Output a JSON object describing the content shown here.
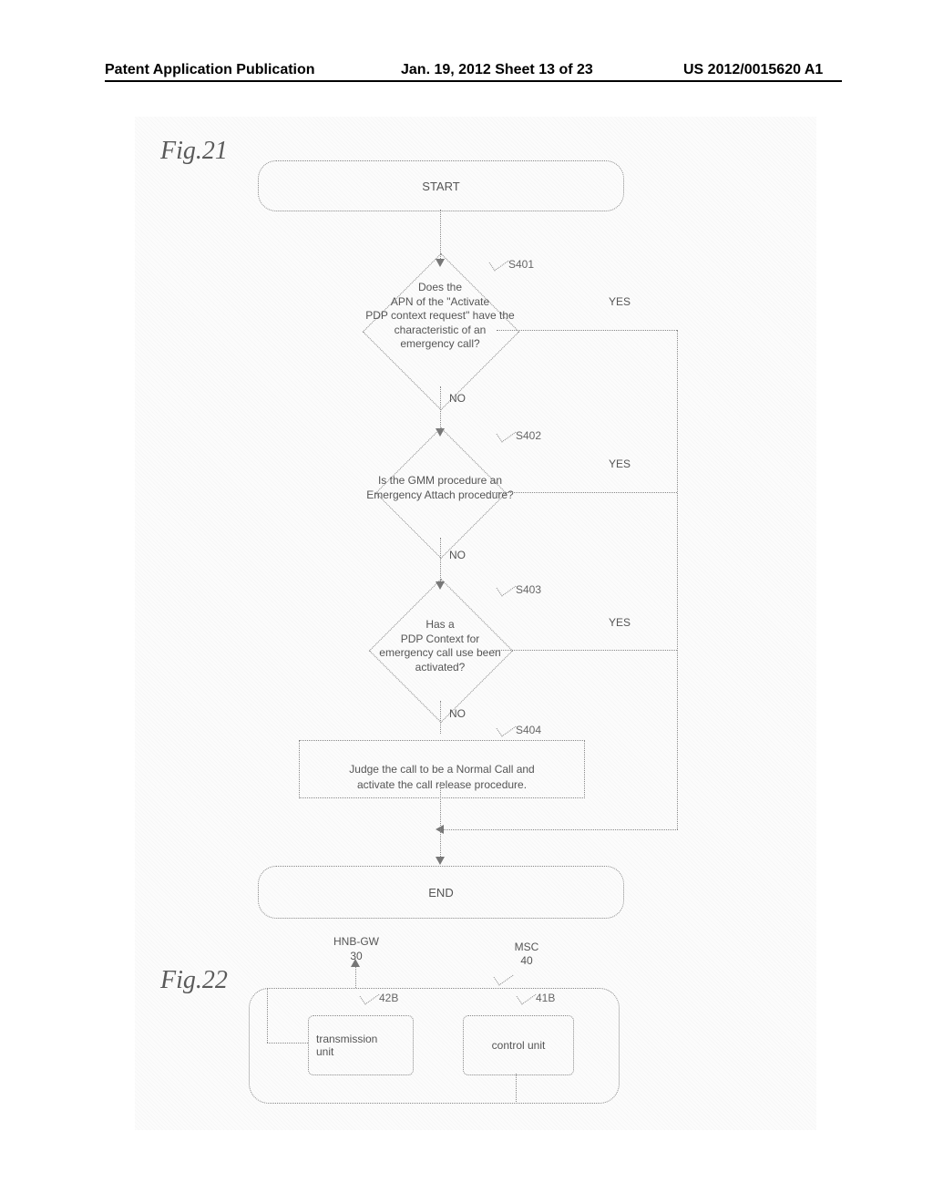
{
  "header": {
    "left": "Patent Application Publication",
    "mid": "Jan. 19, 2012  Sheet 13 of 23",
    "right": "US 2012/0015620 A1"
  },
  "fig21": {
    "label": "Fig.21",
    "start": "START",
    "end": "END",
    "s401": {
      "id": "S401",
      "text": "Does the\nAPN of the \"Activate\nPDP context request\" have the\ncharacteristic of an\nemergency call?"
    },
    "s402": {
      "id": "S402",
      "text": "Is the GMM procedure an\nEmergency Attach procedure?"
    },
    "s403": {
      "id": "S403",
      "text": "Has a\nPDP Context for\nemergency call use been\nactivated?"
    },
    "s404": {
      "id": "S404",
      "text": "Judge the call to be a Normal Call and\nactivate the call release procedure."
    },
    "yes": "YES",
    "no": "NO"
  },
  "fig22": {
    "label": "Fig.22",
    "hnb_gw_label": "HNB-GW",
    "hnb_gw_num": "30",
    "msc_label": "MSC",
    "msc_num": "40",
    "tx_unit_num": "42B",
    "tx_unit_label": "transmission\nunit",
    "ctrl_unit_num": "41B",
    "ctrl_unit_label": "control unit"
  }
}
